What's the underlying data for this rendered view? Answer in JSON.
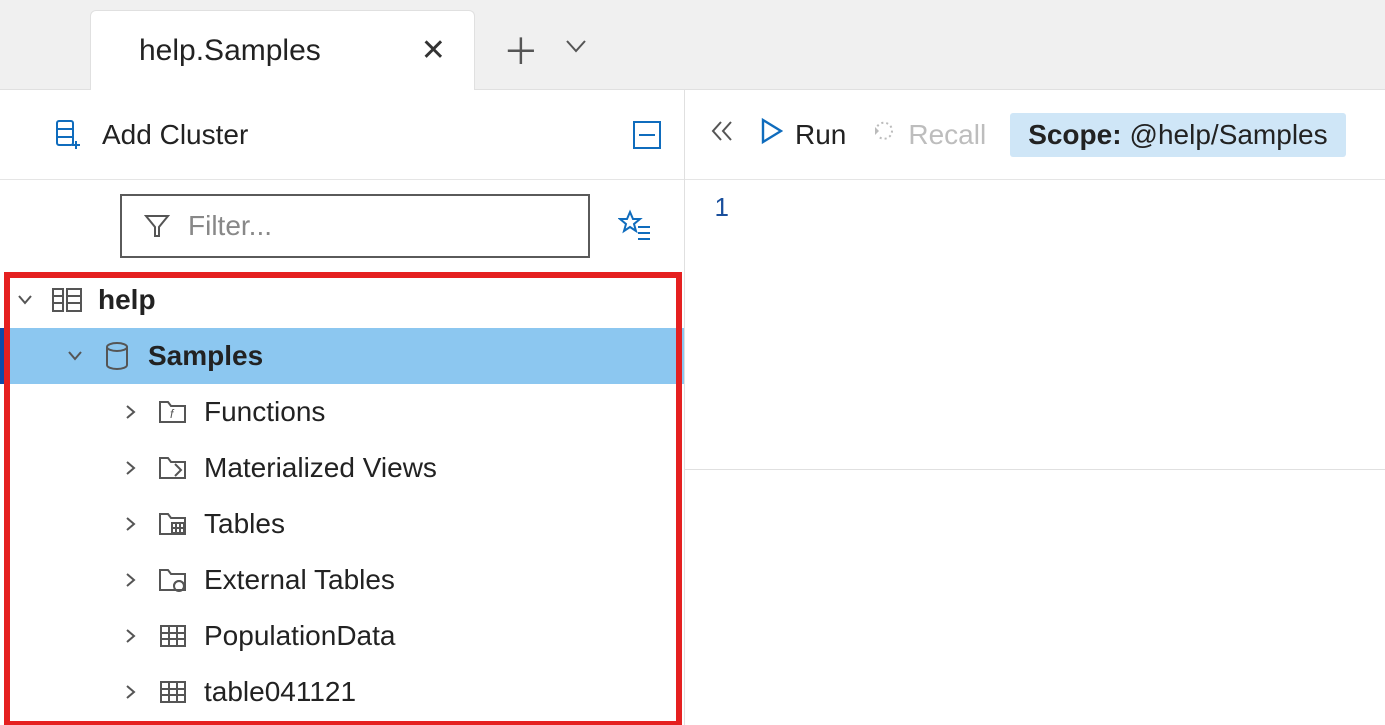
{
  "tabs": {
    "active_title": "help.Samples"
  },
  "toolbar": {
    "add_cluster_label": "Add Cluster"
  },
  "filter": {
    "placeholder": "Filter..."
  },
  "tree": {
    "cluster": "help",
    "database": "Samples",
    "nodes": {
      "functions": "Functions",
      "mat_views": "Materialized Views",
      "tables": "Tables",
      "ext_tables": "External Tables",
      "pop_data": "PopulationData",
      "table04": "table041121"
    }
  },
  "actions": {
    "run": "Run",
    "recall": "Recall",
    "scope_label": "Scope:",
    "scope_value": "@help/Samples"
  },
  "editor": {
    "line_number": "1"
  }
}
